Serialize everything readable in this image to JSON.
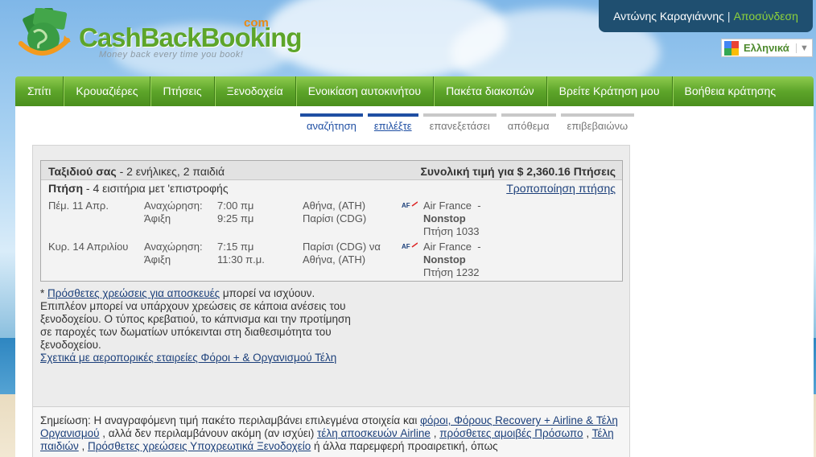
{
  "brand": {
    "name": "CashBackBooking",
    "com": "com",
    "tagline": "Money back every time you book!"
  },
  "user": {
    "name": "Αντώνης Καραγιάννης",
    "separator": "|",
    "logout_label": "Αποσύνδεση"
  },
  "language": {
    "selected": "Ελληνικά",
    "arrow": "▼"
  },
  "nav": {
    "items": [
      {
        "label": "Σπίτι"
      },
      {
        "label": "Κρουαζιέρες"
      },
      {
        "label": "Πτήσεις"
      },
      {
        "label": "Ξενοδοχεία"
      },
      {
        "label": "Ενοικίαση αυτοκινήτου"
      },
      {
        "label": "Πακέτα διακοπών"
      },
      {
        "label": "Βρείτε Κράτηση μου"
      },
      {
        "label": "Βοήθεια κράτησης"
      }
    ]
  },
  "steps": [
    {
      "label": "αναζήτηση"
    },
    {
      "label": "επιλέξτε"
    },
    {
      "label": "επανεξετάσει"
    },
    {
      "label": "απόθεμα"
    },
    {
      "label": "επιβεβαιώνω"
    }
  ],
  "trip": {
    "header_bold": "Ταξιδιού σας",
    "header_rest": " - 2 ενήλικες, 2 παιδιά",
    "total_label": "Συνολική τιμή για $ 2,360.16 Πτήσεις",
    "flight_bold": "Πτήση",
    "flight_rest": " - 4 εισιτήρια μετ 'επιστροφής",
    "modify_label": "Τροποποίηση πτήσης",
    "legs": [
      {
        "date": "Πέμ. 11 Απρ.",
        "depart_label": "Αναχώρηση:",
        "arrive_label": "Άφιξη",
        "depart_time": "7:00 πμ",
        "arrive_time": "9:25 πμ",
        "from": "Αθήνα, (ATH)",
        "to": "Παρίσι (CDG)",
        "airline": "Air France",
        "dash": "-",
        "stops": "Nonstop",
        "flight_no": "Πτήση 1033"
      },
      {
        "date": "Κυρ. 14 Απριλίου",
        "depart_label": "Αναχώρηση:",
        "arrive_label": "Άφιξη",
        "depart_time": "7:15 πμ",
        "arrive_time": "11:30 π.μ.",
        "from": "Παρίσι (CDG) να",
        "to": "Αθήνα, (ATH)",
        "airline": "Air France",
        "dash": "-",
        "stops": "Nonstop",
        "flight_no": "Πτήση 1232"
      }
    ]
  },
  "notes": {
    "asterisk": "* ",
    "baggage_link": "Πρόσθετες χρεώσεις για αποσκευές",
    "baggage_rest": " μπορεί να ισχύουν.",
    "hotel_text": "Επιπλέον μπορεί να υπάρχουν χρεώσεις σε κάποια ανέσεις του ξενοδοχείου. Ο τύπος κρεβατιού, το κάπνισμα και την προτίμηση σε παροχές των δωματίων υπόκεινται στη διαθεσιμότητα του ξενοδοχείου.",
    "taxes_link": "Σχετικά με αεροπορικές εταιρείες Φόροι + & Οργανισμού Τέλη"
  },
  "disclaimer": {
    "prefix": "Σημείωση: Η αναγραφόμενη τιμή πακέτο περιλαμβάνει επιλεγμένα στοιχεία και ",
    "link1": "φόροι, Φόρους Recovery + Airline & Τέλη Οργανισμού",
    "mid1": " , αλλά δεν περιλαμβάνουν ακόμη (αν ισχύει) ",
    "link2": "τέλη αποσκευών Airline",
    "mid2": " , ",
    "link3": "πρόσθετες αμοιβές Πρόσωπο",
    "mid3": " , ",
    "link4": "Τέλη παιδιών",
    "mid4": " , ",
    "link5": "Πρόσθετες χρεώσεις Υποχρεωτικά Ξενοδοχείο",
    "suffix": " ή άλλα παρεμφερή προαιρετική, όπως"
  },
  "colors": {
    "brand_green": "#5da52a",
    "brand_orange": "#e98a16",
    "link_blue": "#1b3f7a",
    "userbar": "#1f4f70"
  }
}
